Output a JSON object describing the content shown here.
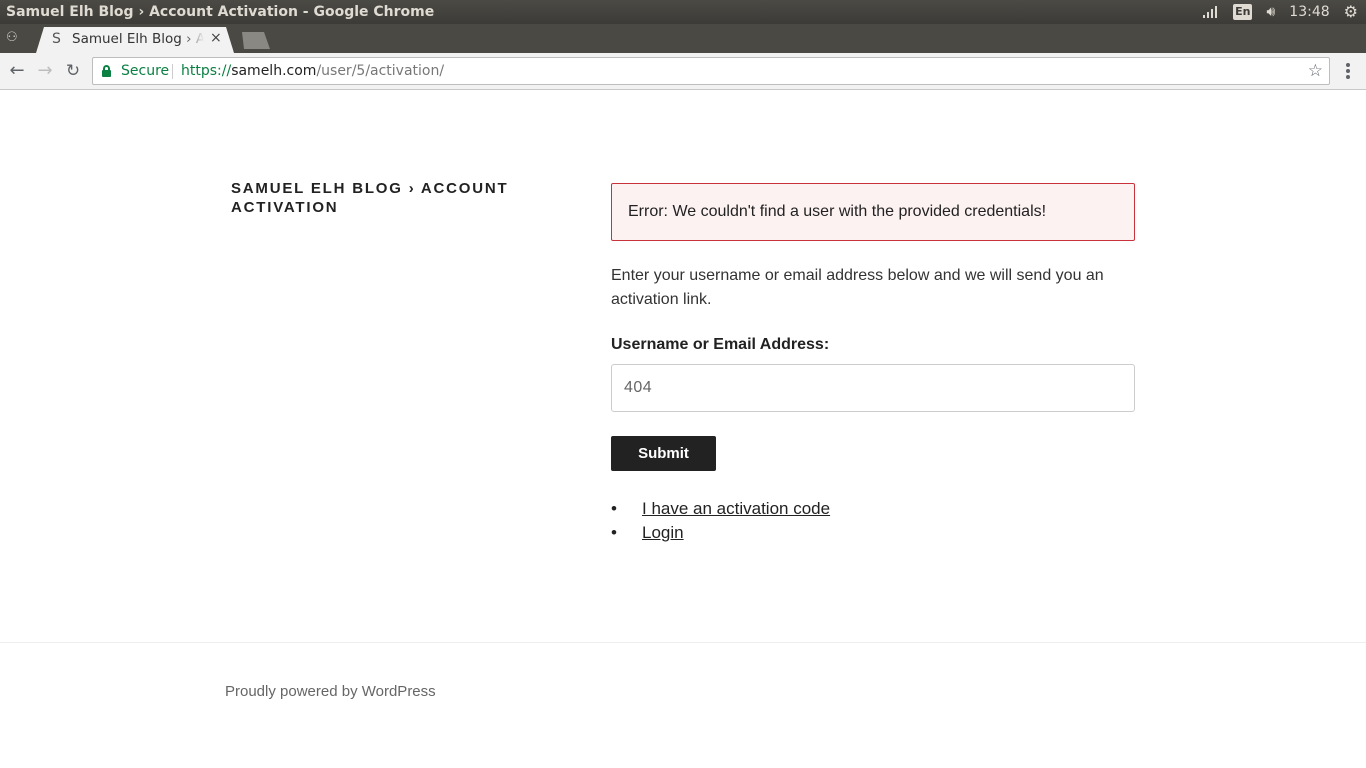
{
  "window": {
    "title": "Samuel Elh Blog › Account Activation - Google Chrome"
  },
  "system_tray": {
    "language": "En",
    "time": "13:48",
    "icons": [
      "signal-icon",
      "keyboard-layout-icon",
      "volume-icon",
      "settings-gear-icon"
    ]
  },
  "browser": {
    "tab": {
      "favicon": "S",
      "title": "Samuel Elh Blog › Account Activation",
      "close": "×"
    },
    "address": {
      "security_label": "Secure",
      "scheme": "https://",
      "host": "samelh.com",
      "path": "/user/5/activation/"
    }
  },
  "page": {
    "site_title": "Samuel Elh Blog › Account Activation",
    "error_message": "Error: We couldn't find a user with the provided credentials!",
    "intro": "Enter your username or email address below and we will send you an activation link.",
    "field_label": "Username or Email Address:",
    "field_value": "404",
    "submit_label": "Submit",
    "links": [
      "I have an activation code",
      "Login"
    ],
    "footer": "Proudly powered by WordPress"
  },
  "colors": {
    "error_border": "#c9323b",
    "error_background": "#fdf2f2",
    "secure_green": "#0b8043",
    "button_background": "#222222"
  }
}
